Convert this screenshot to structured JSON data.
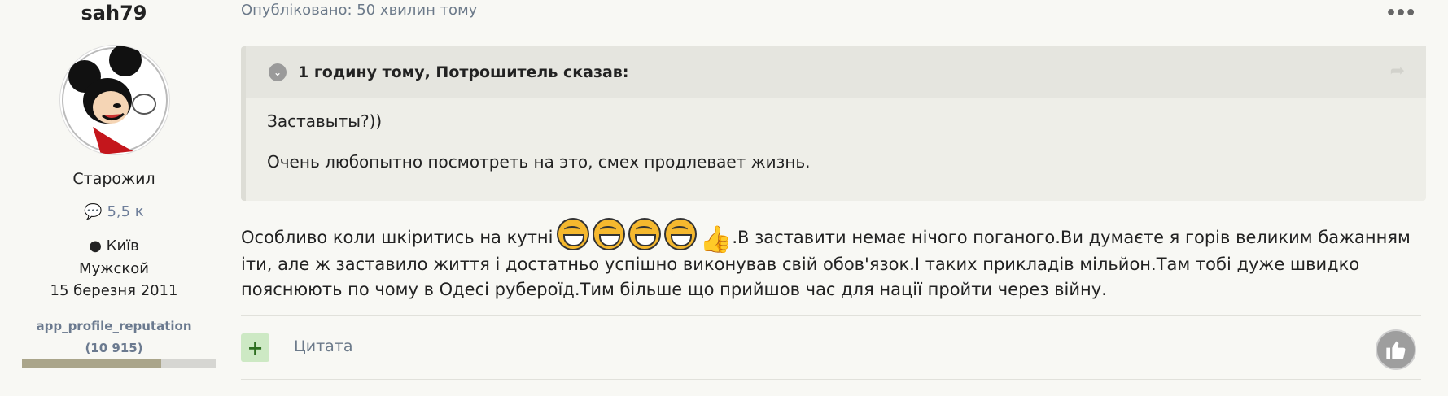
{
  "author": {
    "name": "sah79",
    "title": "Старожил",
    "posts_count": "5,5 к",
    "city": "Київ",
    "gender": "Мужской",
    "joined": "15 березня 2011",
    "reputation_label": "app_profile_reputation",
    "reputation_value": "(10 915)",
    "reputation_fraction": 0.72
  },
  "post": {
    "meta": "Опубліковано: 50 хвилин тому",
    "menu_icon": "more-dots-icon",
    "quote": {
      "header": "1 годину тому, Потрошитель сказав:",
      "lines": [
        "Заставыты?))",
        "Очень любопытно посмотреть на это, смех продлевает жизнь."
      ]
    },
    "text_before_emoji": "Особливо коли шкіритись на кутні",
    "text_after_emoji": ".В заставити немає нічого поганого.Ви думаєте я горів великим бажанням іти, але ж заставило життя і достатньо успішно виконував свій обов'язок.І таких прикладів мільйон.Там тобі дуже швидко пояснюють по чому в Одесі рубероїд.Тим більше що прийшов час для нації пройти через війну.",
    "emoji_icons": [
      "rofl-emoji",
      "rofl-emoji",
      "rofl-emoji",
      "rofl-emoji",
      "thumbs-up-emoji"
    ]
  },
  "actions": {
    "plus_label": "+",
    "quote_label": "Цитата",
    "like_icon": "thumbs-up-icon"
  }
}
